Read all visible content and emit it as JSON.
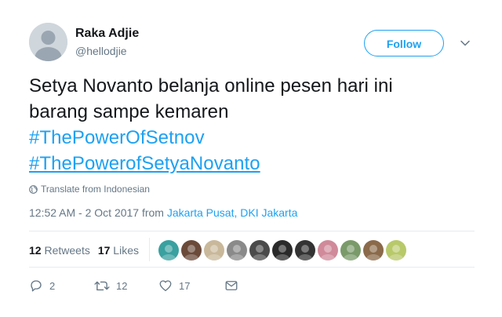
{
  "user": {
    "name": "Raka Adjie",
    "handle": "@hellodjie",
    "follow_label": "Follow"
  },
  "tweet": {
    "line1": "Setya Novanto belanja online pesen hari ini",
    "line2": "barang sampe kemaren",
    "hashtag1": "#ThePowerOfSetnov",
    "hashtag2": "#ThePowerofSetyaNovanto",
    "translate_label": "Translate from Indonesian",
    "time": "12:52 AM - 2 Oct 2017 from ",
    "location": "Jakarta Pusat, DKI Jakarta"
  },
  "stats": {
    "retweets_count": "12",
    "retweets_label": "Retweets",
    "likes_count": "17",
    "likes_label": "Likes"
  },
  "likers": [
    {
      "icon": "liker-avatar-1",
      "color": "#3aa0a0"
    },
    {
      "icon": "liker-avatar-2",
      "color": "#6b4a3a"
    },
    {
      "icon": "liker-avatar-3",
      "color": "#c9b89a"
    },
    {
      "icon": "liker-avatar-4",
      "color": "#8a8a8a"
    },
    {
      "icon": "liker-avatar-5",
      "color": "#4a4a4a"
    },
    {
      "icon": "liker-avatar-6",
      "color": "#2a2a2a"
    },
    {
      "icon": "liker-avatar-7",
      "color": "#333333"
    },
    {
      "icon": "liker-avatar-8",
      "color": "#d08a9a"
    },
    {
      "icon": "liker-avatar-9",
      "color": "#7a9a6a"
    },
    {
      "icon": "liker-avatar-10",
      "color": "#8a6a4a"
    },
    {
      "icon": "liker-avatar-11",
      "color": "#b8c96a"
    }
  ],
  "actions": {
    "reply_count": "2",
    "retweet_count": "12",
    "like_count": "17"
  },
  "colors": {
    "accent": "#1da1f2",
    "muted": "#657786",
    "text": "#14171a"
  }
}
